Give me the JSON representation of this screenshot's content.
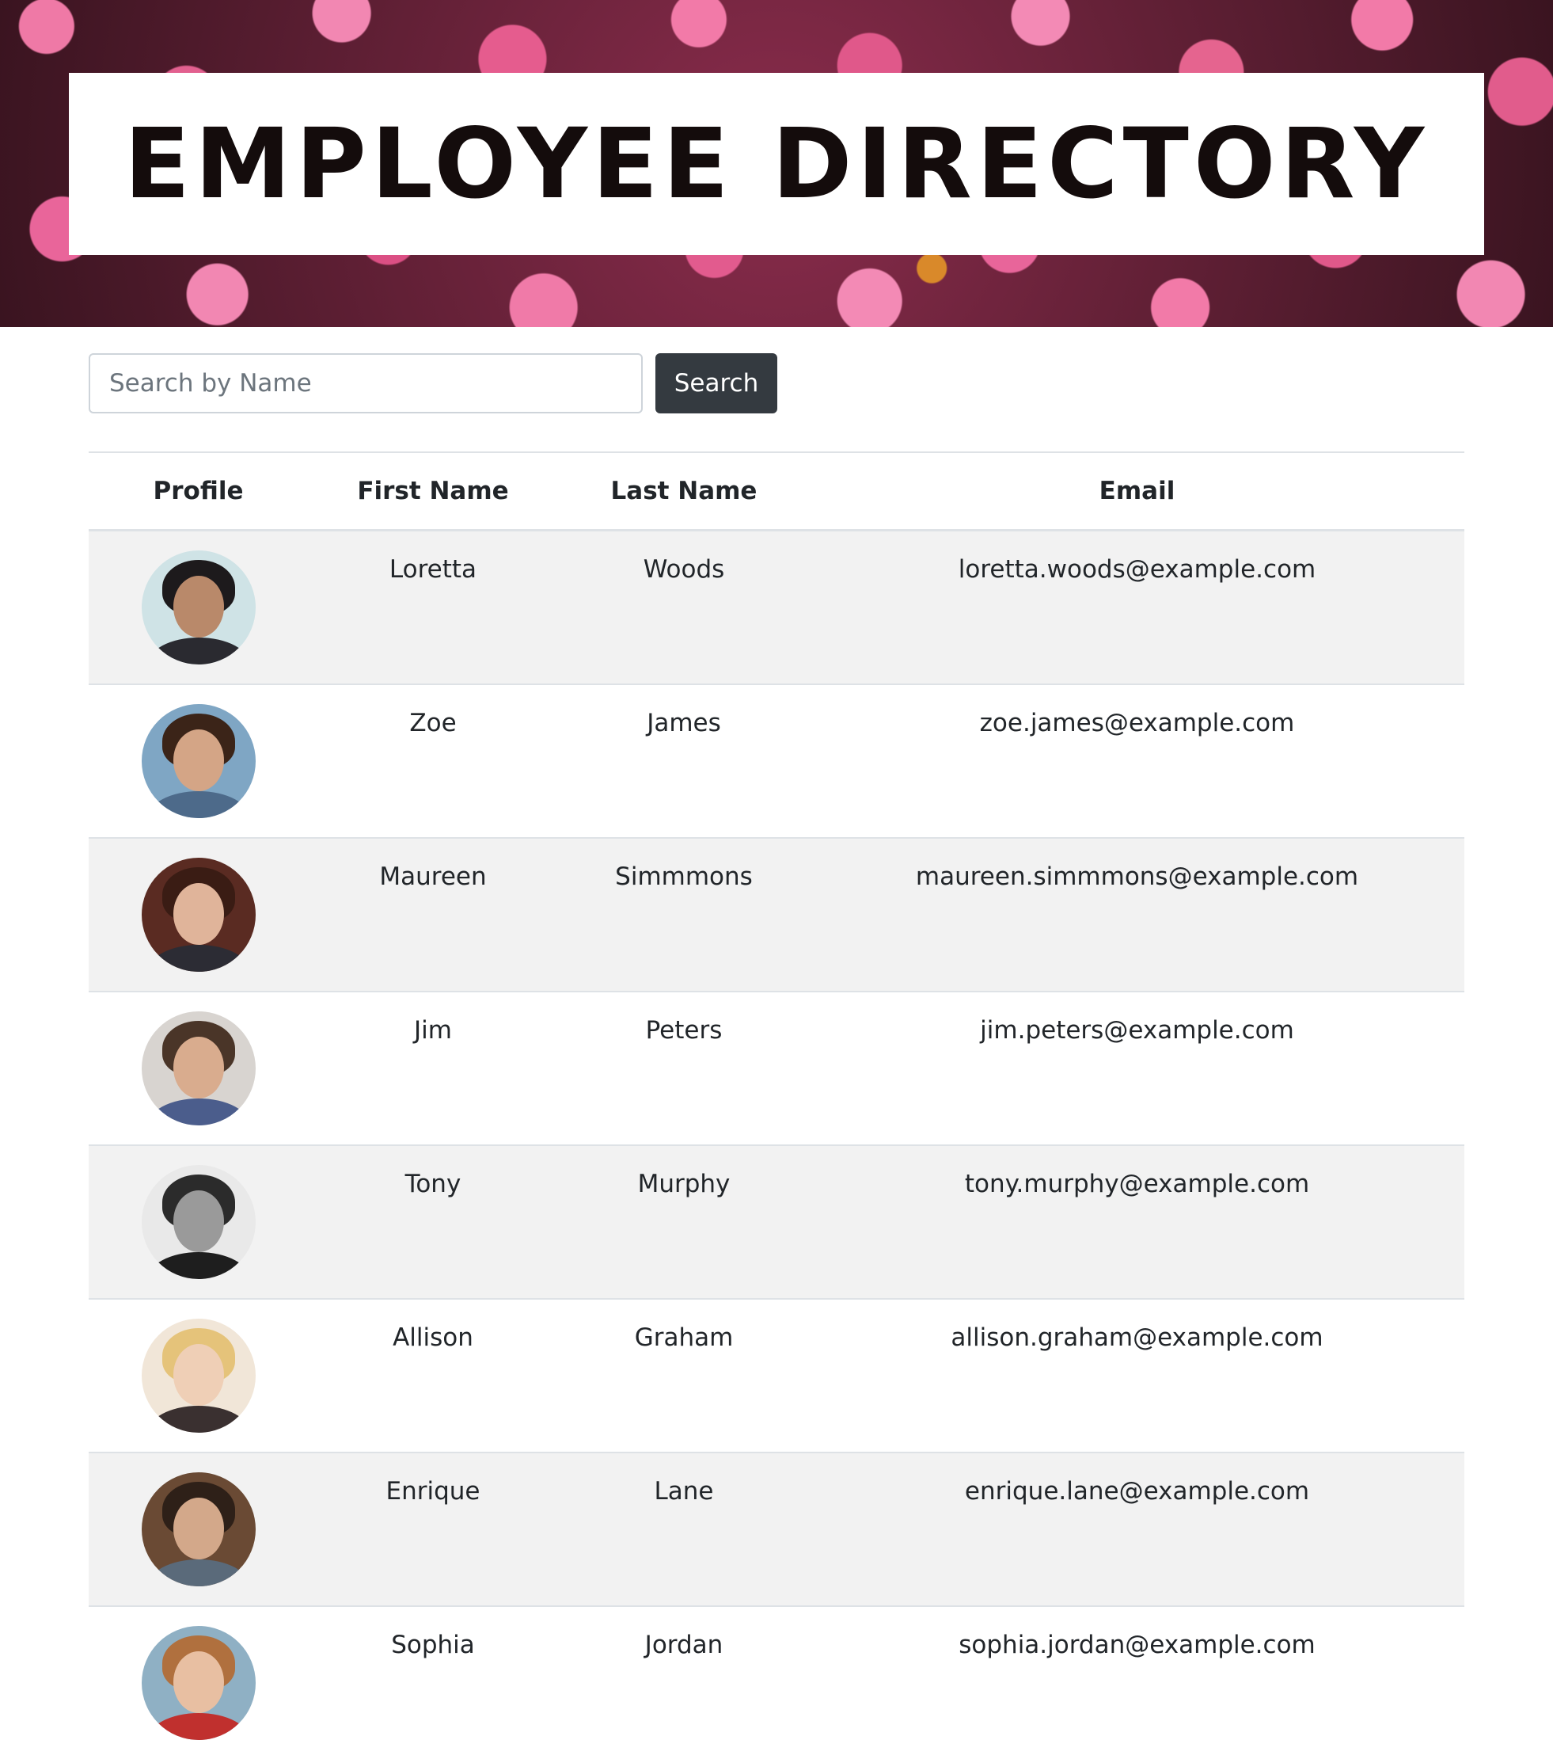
{
  "header": {
    "title": "EMPLOYEE DIRECTORY"
  },
  "search": {
    "placeholder": "Search by Name",
    "button_label": "Search"
  },
  "table": {
    "columns": [
      "Profile",
      "First Name",
      "Last Name",
      "Email"
    ],
    "rows": [
      {
        "first": "Loretta",
        "last": "Woods",
        "email": "loretta.woods@example.com"
      },
      {
        "first": "Zoe",
        "last": "James",
        "email": "zoe.james@example.com"
      },
      {
        "first": "Maureen",
        "last": "Simmmons",
        "email": "maureen.simmmons@example.com"
      },
      {
        "first": "Jim",
        "last": "Peters",
        "email": "jim.peters@example.com"
      },
      {
        "first": "Tony",
        "last": "Murphy",
        "email": "tony.murphy@example.com"
      },
      {
        "first": "Allison",
        "last": "Graham",
        "email": "allison.graham@example.com"
      },
      {
        "first": "Enrique",
        "last": "Lane",
        "email": "enrique.lane@example.com"
      },
      {
        "first": "Sophia",
        "last": "Jordan",
        "email": "sophia.jordan@example.com"
      }
    ]
  },
  "colors": {
    "button_bg": "#343a40",
    "stripe_bg": "#f2f2f2",
    "banner_accent": "#e5648f"
  }
}
